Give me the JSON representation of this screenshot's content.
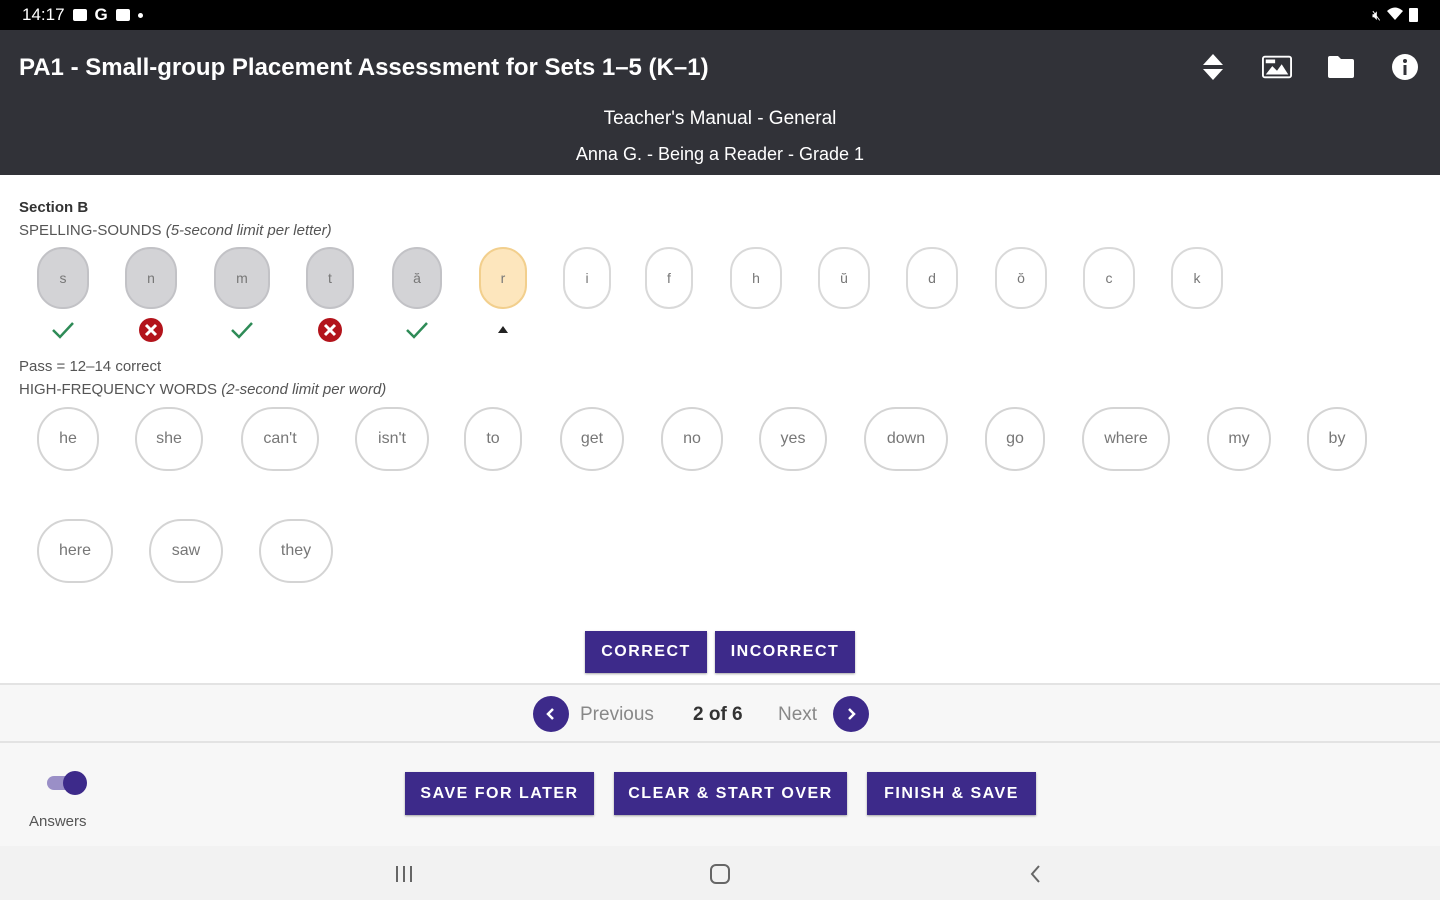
{
  "status_bar": {
    "time": "14:17",
    "left_icons": [
      "gallery-icon",
      "google-icon",
      "calendar-icon",
      "dot-icon"
    ],
    "right_icons": [
      "mute-icon",
      "wifi-icon",
      "battery-icon"
    ]
  },
  "header": {
    "title": "PA1 - Small-group Placement Assessment for Sets 1–5 (K–1)",
    "subtitle": "Teacher's Manual - General",
    "student_line": "Anna  G. - Being a Reader - Grade 1",
    "actions": [
      "sort-icon",
      "image-icon",
      "folder-icon",
      "info-icon"
    ]
  },
  "section": {
    "title": "Section B",
    "spelling": {
      "label": "SPELLING-SOUNDS",
      "note": "(5-second limit per letter)",
      "letters": [
        {
          "text": "s",
          "state": "done",
          "result": "correct"
        },
        {
          "text": "n",
          "state": "done",
          "result": "incorrect"
        },
        {
          "text": "m",
          "state": "done",
          "result": "correct"
        },
        {
          "text": "t",
          "state": "done",
          "result": "incorrect"
        },
        {
          "text": "ă",
          "state": "done",
          "result": "correct"
        },
        {
          "text": "r",
          "state": "current",
          "result": "pending"
        },
        {
          "text": "i",
          "state": "open"
        },
        {
          "text": "f",
          "state": "open"
        },
        {
          "text": "h",
          "state": "open"
        },
        {
          "text": "ŭ",
          "state": "open"
        },
        {
          "text": "d",
          "state": "open"
        },
        {
          "text": "ŏ",
          "state": "open"
        },
        {
          "text": "c",
          "state": "open"
        },
        {
          "text": "k",
          "state": "open"
        }
      ]
    },
    "pass_text": "Pass = 12–14 correct",
    "hf_words": {
      "label": "HIGH-FREQUENCY WORDS",
      "note": "(2-second limit per word)",
      "words": [
        "he",
        "she",
        "can't",
        "isn't",
        "to",
        "get",
        "no",
        "yes",
        "down",
        "go",
        "where",
        "my",
        "by",
        "here",
        "saw",
        "they"
      ]
    }
  },
  "answer_buttons": {
    "correct": "CORRECT",
    "incorrect": "INCORRECT"
  },
  "pager": {
    "previous": "Previous",
    "count": "2 of 6",
    "next": "Next"
  },
  "footer": {
    "toggle_label": "Answers",
    "toggle_on": true,
    "save_later": "SAVE FOR LATER",
    "clear_start": "CLEAR & START OVER",
    "finish_save": "FINISH & SAVE"
  },
  "colors": {
    "primary": "#3d2a8a",
    "header_bg": "#313238",
    "correct": "#2e8b57",
    "incorrect": "#b3131b",
    "current_fill": "#fde6bd"
  }
}
